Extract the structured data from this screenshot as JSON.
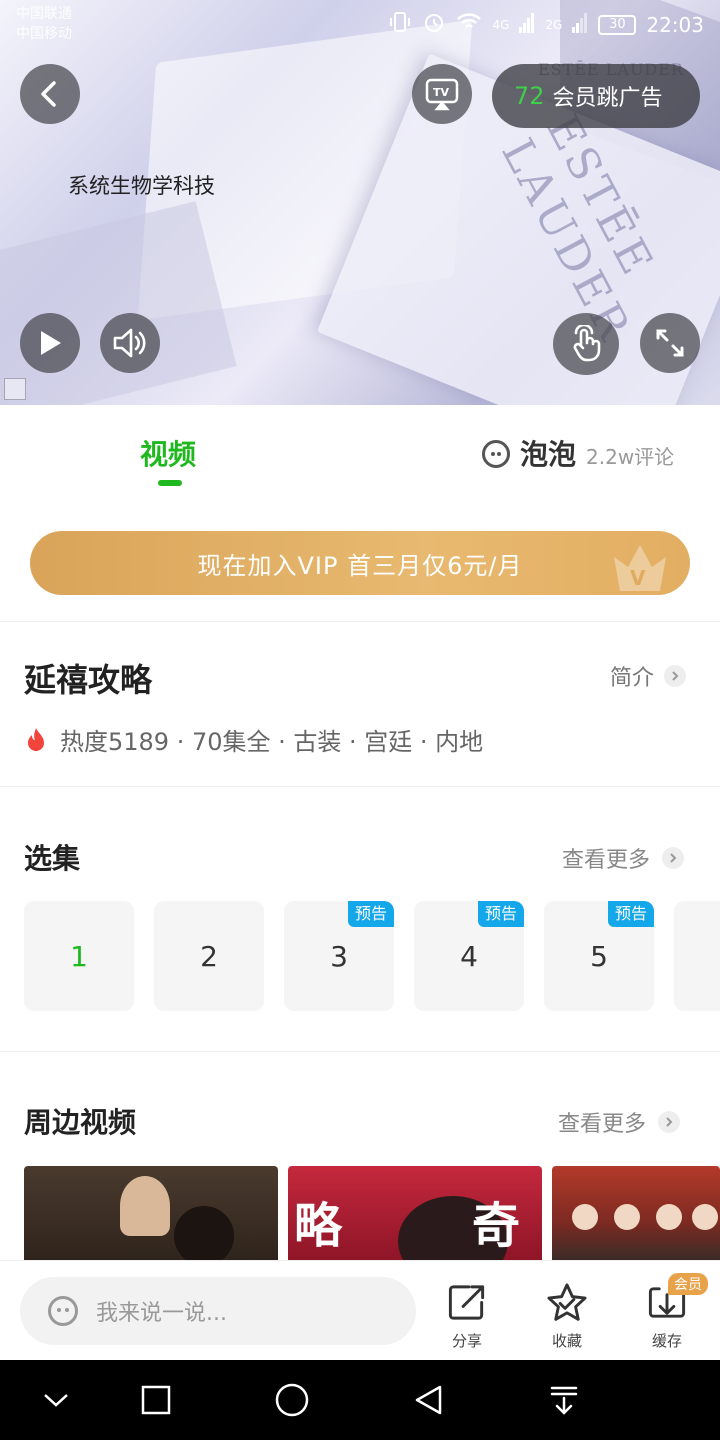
{
  "status_bar": {
    "carrier_1": "中国联通",
    "carrier_2": "中国移动",
    "network_1": "4G",
    "network_2": "2G",
    "battery": "30",
    "time": "22:03"
  },
  "player": {
    "ad_caption": "系统生物学科技",
    "ad_brand": "ESTĒE LAUDER",
    "ad_watermark": "ESTĒE LAUDER",
    "skip_countdown": "72",
    "skip_label": "会员跳广告",
    "icons": [
      "back-icon",
      "tv-cast-icon",
      "play-icon",
      "volume-icon",
      "touch-icon",
      "fullscreen-icon"
    ]
  },
  "tabs": {
    "video_label": "视频",
    "bubble_label": "泡泡",
    "bubble_count": "2.2w评论"
  },
  "vip_banner": {
    "text": "现在加入VIP 首三月仅6元/月"
  },
  "show": {
    "title": "延禧攻略",
    "intro_label": "简介",
    "meta": "热度5189 · 70集全 · 古装 · 宫廷 · 内地"
  },
  "episodes": {
    "title": "选集",
    "more_label": "查看更多",
    "items": [
      {
        "num": "1",
        "badge": ""
      },
      {
        "num": "2",
        "badge": ""
      },
      {
        "num": "3",
        "badge": "预告"
      },
      {
        "num": "4",
        "badge": "预告"
      },
      {
        "num": "5",
        "badge": "预告"
      }
    ]
  },
  "related": {
    "title": "周边视频",
    "more_label": "查看更多",
    "thumb2_left": "略",
    "thumb2_right": "奇"
  },
  "bottom_bar": {
    "comment_placeholder": "我来说一说...",
    "share_label": "分享",
    "favorite_label": "收藏",
    "download_label": "缓存",
    "download_badge": "会员"
  },
  "colors": {
    "accent_green": "#1fb91f",
    "vip_gold": "#e2ae62",
    "preview_badge": "#14a8ea"
  }
}
